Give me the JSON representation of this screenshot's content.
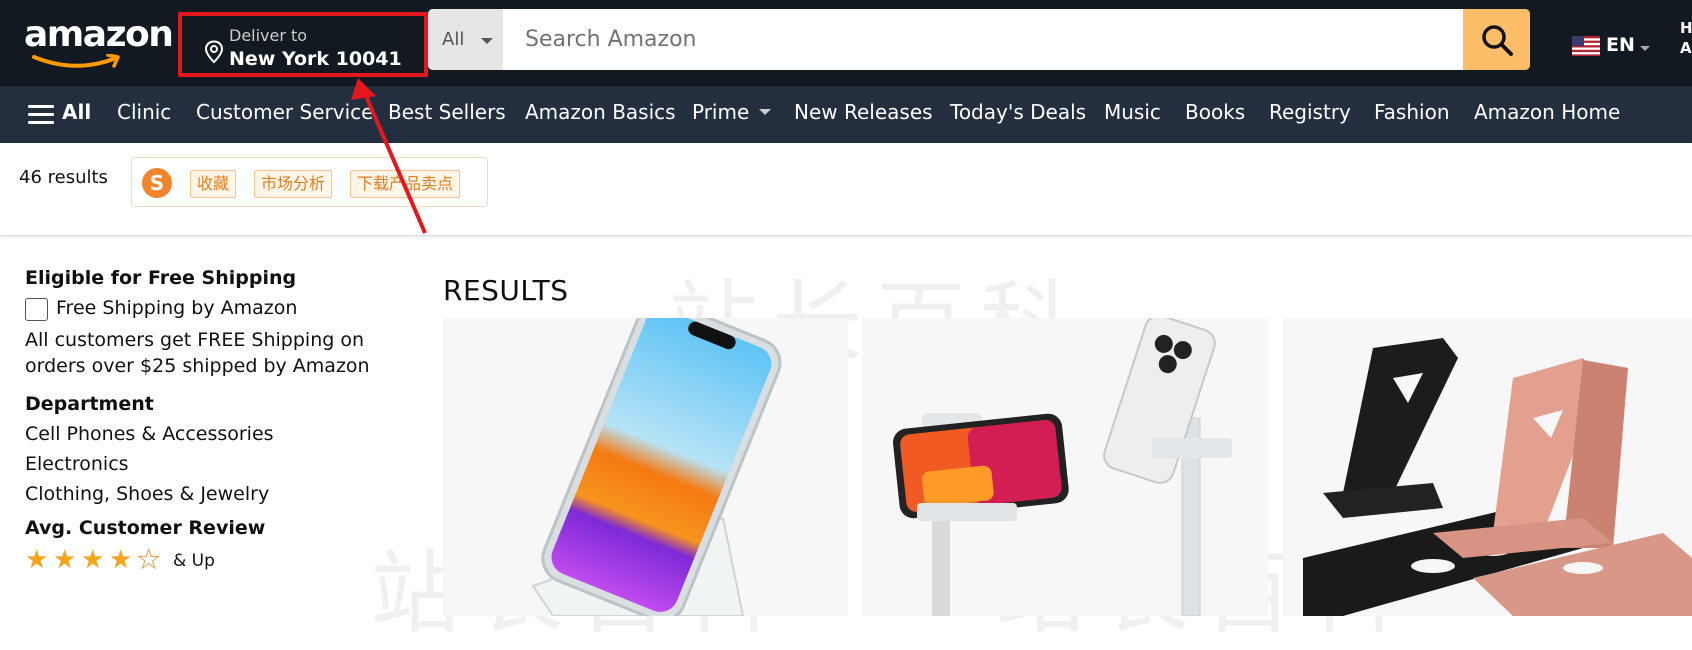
{
  "header": {
    "logo_text": "amazon",
    "deliver": {
      "label": "Deliver to",
      "location": "New York 10041"
    },
    "search": {
      "category": "All",
      "placeholder": "Search Amazon"
    },
    "language": "EN",
    "account_partial": "H A"
  },
  "nav": {
    "all": "All",
    "items": [
      "Clinic",
      "Customer Service",
      "Best Sellers",
      "Amazon Basics",
      "Prime",
      "New Releases",
      "Today's Deals",
      "Music",
      "Books",
      "Registry",
      "Fashion",
      "Amazon Home"
    ]
  },
  "results_bar": {
    "count": "46 results",
    "extension": {
      "logo": "S",
      "tags": [
        "收藏",
        "市场分析",
        "下载产品卖点"
      ]
    }
  },
  "sidebar": {
    "shipping": {
      "heading": "Eligible for Free Shipping",
      "checkbox_label": "Free Shipping by Amazon",
      "note": [
        "All customers get FREE Shipping on",
        "orders over $25 shipped by Amazon"
      ]
    },
    "department": {
      "heading": "Department",
      "items": [
        "Cell Phones & Accessories",
        "Electronics",
        "Clothing, Shoes & Jewelry"
      ]
    },
    "review": {
      "heading": "Avg. Customer Review",
      "stars": 4,
      "suffix": "& Up"
    }
  },
  "main": {
    "results_title": "RESULTS"
  },
  "watermark": "站长百科",
  "colors": {
    "header": "#131921",
    "nav": "#232f3e",
    "search_button": "#febd69",
    "highlight": "#e4161e",
    "star": "#f4a41d"
  }
}
